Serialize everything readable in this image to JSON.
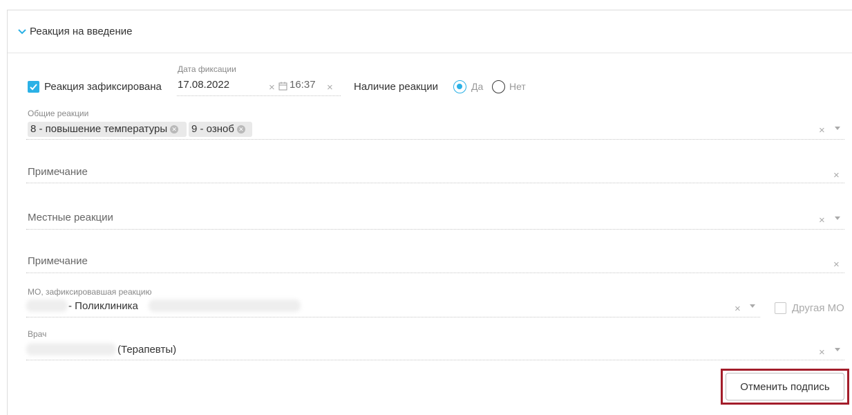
{
  "section": {
    "title": "Реакция на введение"
  },
  "reaction_recorded": {
    "label": "Реакция зафиксирована",
    "checked": true
  },
  "fixation_date": {
    "label": "Дата фиксации",
    "date": "17.08.2022",
    "time": "16:37"
  },
  "reaction_presence": {
    "label": "Наличие реакции",
    "options": [
      {
        "label": "Да",
        "selected": true
      },
      {
        "label": "Нет",
        "selected": false
      }
    ]
  },
  "general_reactions": {
    "label": "Общие реакции",
    "tags": [
      "8 - повышение температуры",
      "9 - озноб"
    ]
  },
  "note_general": {
    "placeholder": "Примечание"
  },
  "local_reactions": {
    "placeholder": "Местные реакции"
  },
  "note_local": {
    "placeholder": "Примечание"
  },
  "organization": {
    "label": "МО, зафиксировавшая реакцию",
    "value_visible": "- Поликлиника"
  },
  "other_mo": {
    "label": "Другая МО",
    "checked": false
  },
  "doctor": {
    "label": "Врач",
    "value_visible": "(Терапевты)"
  },
  "actions": {
    "cancel_signature": "Отменить подпись"
  },
  "colors": {
    "accent": "#2bb1e6",
    "highlight_frame": "#a31d2a"
  }
}
